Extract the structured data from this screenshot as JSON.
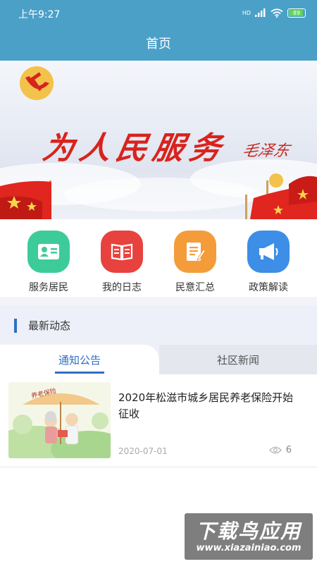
{
  "status_bar": {
    "time": "上午9:27",
    "network": "HD",
    "battery": "89"
  },
  "header": {
    "title": "首页"
  },
  "banner": {
    "slogan": "为人民服务",
    "signature": "毛泽东"
  },
  "menu": [
    {
      "label": "服务居民",
      "icon": "id-card-icon",
      "color": "#3ecb9a"
    },
    {
      "label": "我的日志",
      "icon": "book-icon",
      "color": "#e8423f"
    },
    {
      "label": "民意汇总",
      "icon": "document-edit-icon",
      "color": "#f59c3a"
    },
    {
      "label": "政策解读",
      "icon": "megaphone-icon",
      "color": "#3d8ee6"
    }
  ],
  "news": {
    "section_title": "最新动态",
    "tabs": [
      {
        "label": "通知公告",
        "active": true
      },
      {
        "label": "社区新闻",
        "active": false
      }
    ],
    "items": [
      {
        "title": "2020年松滋市城乡居民养老保险开始征收",
        "date": "2020-07-01",
        "views": "6",
        "thumb_caption": "养老保险"
      }
    ]
  },
  "watermark": {
    "title": "下载鸟应用",
    "url": "www.xiazainiao.com"
  },
  "colors": {
    "header": "#4ba0c8",
    "accent": "#2f6fc4",
    "slogan": "#d8231d"
  }
}
